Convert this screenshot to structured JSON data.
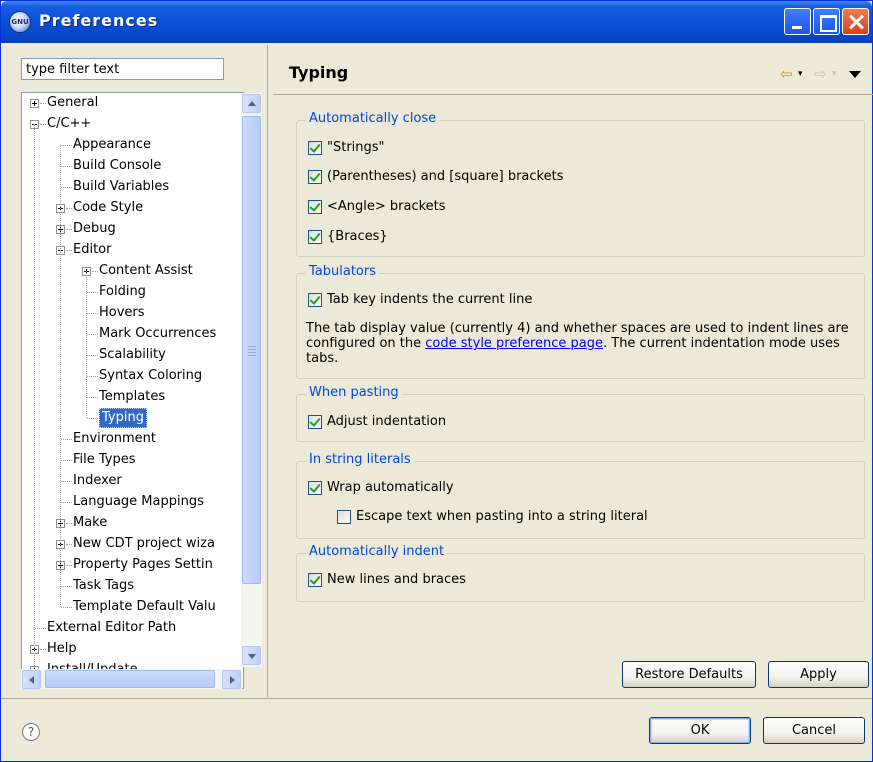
{
  "window": {
    "title": "Preferences",
    "icon_text": "GNU"
  },
  "filter": {
    "placeholder": "type filter text",
    "value": "type filter text"
  },
  "tree": [
    {
      "label": "General",
      "level": 0,
      "expander": "plus"
    },
    {
      "label": "C/C++",
      "level": 0,
      "expander": "minus"
    },
    {
      "label": "Appearance",
      "level": 1,
      "expander": "none"
    },
    {
      "label": "Build Console",
      "level": 1,
      "expander": "none"
    },
    {
      "label": "Build Variables",
      "level": 1,
      "expander": "none"
    },
    {
      "label": "Code Style",
      "level": 1,
      "expander": "plus"
    },
    {
      "label": "Debug",
      "level": 1,
      "expander": "plus"
    },
    {
      "label": "Editor",
      "level": 1,
      "expander": "minus"
    },
    {
      "label": "Content Assist",
      "level": 2,
      "expander": "plus"
    },
    {
      "label": "Folding",
      "level": 2,
      "expander": "none"
    },
    {
      "label": "Hovers",
      "level": 2,
      "expander": "none"
    },
    {
      "label": "Mark Occurrences",
      "level": 2,
      "expander": "none"
    },
    {
      "label": "Scalability",
      "level": 2,
      "expander": "none"
    },
    {
      "label": "Syntax Coloring",
      "level": 2,
      "expander": "none"
    },
    {
      "label": "Templates",
      "level": 2,
      "expander": "none"
    },
    {
      "label": "Typing",
      "level": 2,
      "expander": "none",
      "selected": true
    },
    {
      "label": "Environment",
      "level": 1,
      "expander": "none"
    },
    {
      "label": "File Types",
      "level": 1,
      "expander": "none"
    },
    {
      "label": "Indexer",
      "level": 1,
      "expander": "none"
    },
    {
      "label": "Language Mappings",
      "level": 1,
      "expander": "none"
    },
    {
      "label": "Make",
      "level": 1,
      "expander": "plus"
    },
    {
      "label": "New CDT project wiza",
      "level": 1,
      "expander": "plus"
    },
    {
      "label": "Property Pages Settin",
      "level": 1,
      "expander": "plus"
    },
    {
      "label": "Task Tags",
      "level": 1,
      "expander": "none"
    },
    {
      "label": "Template Default Valu",
      "level": 1,
      "expander": "none"
    },
    {
      "label": "External Editor Path",
      "level": 0,
      "expander": "none"
    },
    {
      "label": "Help",
      "level": 0,
      "expander": "plus"
    },
    {
      "label": "Install/Update",
      "level": 0,
      "expander": "plus"
    }
  ],
  "page": {
    "title": "Typing",
    "nav_back": "⇦",
    "nav_forward": "⇨",
    "dropdown_glyph": "▾"
  },
  "groups": {
    "auto_close": {
      "title": "Automatically close",
      "items": [
        {
          "label": "\"Strings\"",
          "checked": true
        },
        {
          "label": "(Parentheses) and [square] brackets",
          "checked": true
        },
        {
          "label": "<Angle> brackets",
          "checked": true
        },
        {
          "label": "{Braces}",
          "checked": true
        }
      ]
    },
    "tabulators": {
      "title": "Tabulators",
      "item": {
        "label": "Tab key indents the current line",
        "checked": true
      },
      "description_prefix": "The tab display value (currently 4) and whether spaces are used to indent lines are configured on the ",
      "link": "code style preference page",
      "description_suffix": ". The current indentation mode uses tabs."
    },
    "pasting": {
      "title": "When pasting",
      "item": {
        "label": "Adjust indentation",
        "checked": true
      }
    },
    "string_literals": {
      "title": "In string literals",
      "items": [
        {
          "label": "Wrap automatically",
          "checked": true
        },
        {
          "label": "Escape text when pasting into a string literal",
          "checked": false
        }
      ]
    },
    "auto_indent": {
      "title": "Automatically indent",
      "item": {
        "label": "New lines and braces",
        "checked": true
      }
    }
  },
  "buttons": {
    "restore_defaults": "Restore Defaults",
    "apply": "Apply",
    "ok": "OK",
    "cancel": "Cancel",
    "help": "?"
  }
}
